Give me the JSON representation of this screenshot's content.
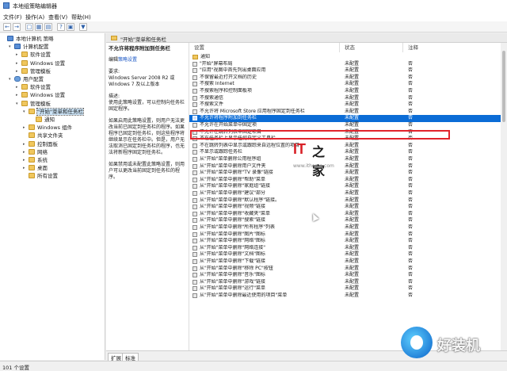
{
  "window": {
    "title": "本地组策略编辑器"
  },
  "menu": [
    "文件(F)",
    "操作(A)",
    "查看(V)",
    "帮助(H)"
  ],
  "toolbar": [
    "back-icon",
    "forward-icon",
    "up-icon",
    "show-hide-tree-icon",
    "export-icon",
    "help-icon",
    "properties-icon",
    "filter-icon"
  ],
  "tree": [
    {
      "label": "本地计算机 策略",
      "icon": "pc",
      "level": 0,
      "exp": ""
    },
    {
      "label": "计算机配置",
      "icon": "pc",
      "level": 1,
      "exp": "v"
    },
    {
      "label": "软件设置",
      "icon": "folder",
      "level": 2,
      "exp": ">"
    },
    {
      "label": "Windows 设置",
      "icon": "folder",
      "level": 2,
      "exp": ">"
    },
    {
      "label": "管理模板",
      "icon": "folder",
      "level": 2,
      "exp": ">"
    },
    {
      "label": "用户配置",
      "icon": "user",
      "level": 1,
      "exp": "v"
    },
    {
      "label": "软件设置",
      "icon": "folder",
      "level": 2,
      "exp": ">"
    },
    {
      "label": "Windows 设置",
      "icon": "folder",
      "level": 2,
      "exp": ">"
    },
    {
      "label": "管理模板",
      "icon": "folder",
      "level": 2,
      "exp": "v"
    },
    {
      "label": "\"开始\"菜单和任务栏",
      "icon": "folder",
      "level": 3,
      "exp": "v",
      "selected": true
    },
    {
      "label": "通知",
      "icon": "folder",
      "level": 4,
      "exp": ""
    },
    {
      "label": "Windows 组件",
      "icon": "folder",
      "level": 3,
      "exp": ">"
    },
    {
      "label": "共享文件夹",
      "icon": "folder",
      "level": 3,
      "exp": ""
    },
    {
      "label": "控制面板",
      "icon": "folder",
      "level": 3,
      "exp": ">"
    },
    {
      "label": "网络",
      "icon": "folder",
      "level": 3,
      "exp": ">"
    },
    {
      "label": "系统",
      "icon": "folder",
      "level": 3,
      "exp": ">"
    },
    {
      "label": "桌面",
      "icon": "folder",
      "level": 3,
      "exp": ">"
    },
    {
      "label": "所有设置",
      "icon": "folder",
      "level": 3,
      "exp": ""
    }
  ],
  "detail": {
    "header": "\"开始\"菜单和任务栏",
    "policy_title": "不允许将程序附加到任务栏",
    "edit_prefix": "编辑",
    "edit_link": "策略设置",
    "requirements_label": "要求:",
    "requirements_text": "Windows Server 2008 R2 或 Windows 7 及以上版本",
    "description_label": "描述:",
    "description_p1": "使用此策略设置，可以控制向任务栏固定程序。",
    "description_p2": "如果启用此策略设置，则用户无法更改当前已固定到任务栏的程序。如果程序已固定到任务栏，则这些程序将继续显示在任务栏中。但是，用户无法取消已固定到任务栏的程序，也无法将新程序固定到任务栏。",
    "description_p3": "如果禁用或未配置此策略设置，则用户可以更改当前固定到任务栏的程序。"
  },
  "columns": {
    "setting": "设置",
    "state": "状态",
    "comment": "注释"
  },
  "rows": [
    {
      "name": "通知",
      "type": "folder",
      "state": "",
      "comment": ""
    },
    {
      "name": "\"开始\"屏幕布局",
      "state": "未配置",
      "comment": "否"
    },
    {
      "name": "\"应用\"视图中首先列出桌面应用",
      "state": "未配置",
      "comment": "否"
    },
    {
      "name": "不保留最近打开文档的历史",
      "state": "未配置",
      "comment": "否"
    },
    {
      "name": "不搜索 Internet",
      "state": "未配置",
      "comment": "否"
    },
    {
      "name": "不搜索程序和控制面板项",
      "state": "未配置",
      "comment": "否"
    },
    {
      "name": "不搜索通信",
      "state": "未配置",
      "comment": "否"
    },
    {
      "name": "不搜索文件",
      "state": "未配置",
      "comment": "否"
    },
    {
      "name": "不允许将 Microsoft Store 应用程序固定到任务栏",
      "state": "未配置",
      "comment": "否"
    },
    {
      "name": "不允许将程序附加到任务栏",
      "state": "未配置",
      "comment": "否",
      "selected": true
    },
    {
      "name": "不允许在开始菜单中固定项",
      "state": "未配置",
      "comment": "否"
    },
    {
      "name": "不允许在跳转列表中固定项目",
      "state": "未配置",
      "comment": "否"
    },
    {
      "name": "不在任务栏上显示任何自定义工具栏",
      "state": "未配置",
      "comment": "否"
    },
    {
      "name": "不在跳转列表中显示或跟踪来自远程位置的项目",
      "state": "未配置",
      "comment": "否"
    },
    {
      "name": "不显示或跟踪任务栏",
      "state": "未配置",
      "comment": "否"
    },
    {
      "name": "从\"开始\"菜单删除公用程序组",
      "state": "未配置",
      "comment": "否"
    },
    {
      "name": "从\"开始\"菜单中删除用户文件夹",
      "state": "未配置",
      "comment": "否"
    },
    {
      "name": "从\"开始\"菜单中删除\"TV 录像\"链接",
      "state": "未配置",
      "comment": "否"
    },
    {
      "name": "从\"开始\"菜单中删除\"帮助\"菜单",
      "state": "未配置",
      "comment": "否"
    },
    {
      "name": "从\"开始\"菜单中删除\"家庭组\"链接",
      "state": "未配置",
      "comment": "否"
    },
    {
      "name": "从\"开始\"菜单中删除\"建议\"部分",
      "state": "未配置",
      "comment": "否"
    },
    {
      "name": "从\"开始\"菜单中删除\"默认程序\"链接。",
      "state": "未配置",
      "comment": "否"
    },
    {
      "name": "从\"开始\"菜单中删除\"视频\"链接",
      "state": "未配置",
      "comment": "否"
    },
    {
      "name": "从\"开始\"菜单中删除\"收藏夹\"菜单",
      "state": "未配置",
      "comment": "否"
    },
    {
      "name": "从\"开始\"菜单中删除\"搜索\"链接",
      "state": "未配置",
      "comment": "否"
    },
    {
      "name": "从\"开始\"菜单中删除\"所有程序\"列表",
      "state": "未配置",
      "comment": "否"
    },
    {
      "name": "从\"开始\"菜单中删除\"图片\"图标",
      "state": "未配置",
      "comment": "否"
    },
    {
      "name": "从\"开始\"菜单中删除\"网络\"图标",
      "state": "未配置",
      "comment": "否"
    },
    {
      "name": "从\"开始\"菜单中删除\"网络连接\"",
      "state": "未配置",
      "comment": "否"
    },
    {
      "name": "从\"开始\"菜单中删除\"文档\"图标",
      "state": "未配置",
      "comment": "否"
    },
    {
      "name": "从\"开始\"菜单中删除\"下载\"链接",
      "state": "未配置",
      "comment": "否"
    },
    {
      "name": "从\"开始\"菜单中删除\"移除 PC\"按钮",
      "state": "未配置",
      "comment": "否"
    },
    {
      "name": "从\"开始\"菜单中删除\"音乐\"图标",
      "state": "未配置",
      "comment": "否"
    },
    {
      "name": "从\"开始\"菜单中删除\"游戏\"链接",
      "state": "未配置",
      "comment": "否"
    },
    {
      "name": "从\"开始\"菜单中删除\"运行\"菜单",
      "state": "未配置",
      "comment": "否"
    },
    {
      "name": "从\"开始\"菜单中删除最近使用的项目\"菜单",
      "state": "未配置",
      "comment": "否"
    }
  ],
  "tabs": [
    "扩展",
    "标准"
  ],
  "status": "101 个设置",
  "watermarks": {
    "ithome_logo": "IT之家",
    "ithome_url": "www.ithome.com",
    "hzj": "好装机"
  }
}
